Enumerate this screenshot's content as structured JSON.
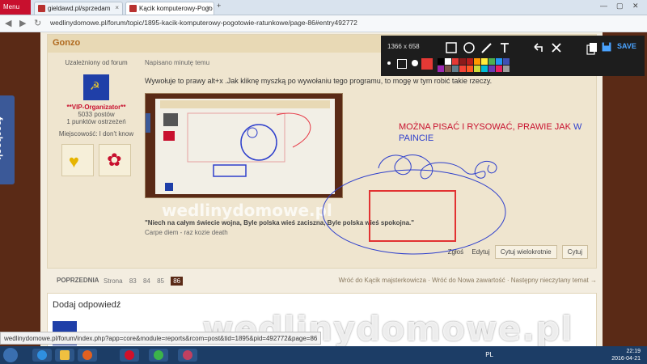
{
  "browser": {
    "menu_label": "Menu",
    "tabs": [
      {
        "label": "gieldawd.pl/sprzedam"
      },
      {
        "label": "Kącik komputerowy-Pogo"
      }
    ],
    "url": "wedlinydomowe.pl/forum/topic/1895-kacik-komputerowy-pogotowie-ratunkowe/page-86#entry492772"
  },
  "facebook_tab": "facebook",
  "post": {
    "author": "Gonzo",
    "user_title": "Uzależniony od forum",
    "rank": "**VIP-Organizator**",
    "post_count": "5033 postów",
    "warnings": "1 punktów ostrzeżeń",
    "location": "Miejscowość: I don't know",
    "posted_time": "Napisano minutę temu",
    "message": "Wywołuje to prawy alt+x .Jak kliknę myszką po wywołaniu tego programu, to mogę w tym robić takie rzeczy.",
    "quote": "\"Niech na całym świecie wojna, Byle polska wieś zaciszna, Byle polska wieś spokojna.\"",
    "signature": "Carpe diem - raz kozie death",
    "actions": {
      "report": "Zgłoś",
      "edit": "Edytuj",
      "multiquote": "Cytuj wielokrotnie",
      "quote": "Cytuj"
    }
  },
  "pager": {
    "prev": "POPRZEDNIA",
    "pages": [
      "Strona",
      "83",
      "84",
      "85",
      "86"
    ],
    "current": "86",
    "links": "Wróć do Kącik majsterkowicza · Wróć do Nowa zawartość · Następny nieczytany temat →"
  },
  "reply": {
    "title": "Dodaj odpowiedź"
  },
  "annotation": {
    "text_red": "MOŻNA PISAĆ I RYSOWAĆ, PRAWIE JAK",
    "text_blue_1": "W",
    "text_blue_2": "PAINCIE"
  },
  "watermark": "wedlinydomowe.pl",
  "snipping_toolbar": {
    "width_value": "1366",
    "dims_sep": "x",
    "height_value": "658",
    "save_label": "SAVE",
    "palette": [
      "#000000",
      "#ffffff",
      "#e53935",
      "#8b1a1a",
      "#b71c1c",
      "#ff9800",
      "#ffeb3b",
      "#4caf50",
      "#2196f3",
      "#3f51b5",
      "#9c27b0",
      "#795548",
      "#607d8b",
      "#f44336",
      "#ff5722",
      "#cddc39",
      "#00bcd4",
      "#673ab7",
      "#e91e63",
      "#9e9e9e"
    ]
  },
  "status_url": "wedlinydomowe.pl/forum/index.php?app=core&module=reports&rcom=post&tid=1895&pid=492772&page=86",
  "taskbar": {
    "lang": "PL",
    "time": "22:19",
    "date": "2016-04-21"
  },
  "colors": {
    "annotation_red": "#c8102e",
    "annotation_blue": "#2e3fcc",
    "page_brown": "#5a2a16"
  }
}
